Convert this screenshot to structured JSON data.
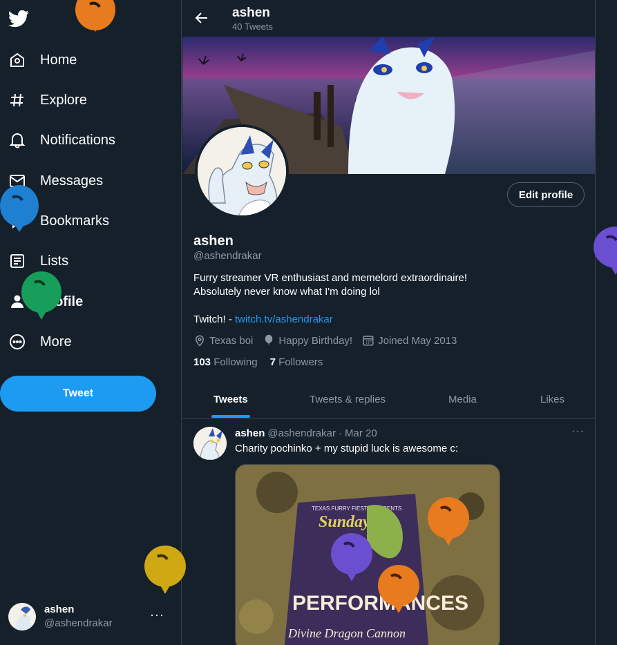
{
  "sidebar": {
    "items": [
      {
        "label": "Home",
        "icon": "home-icon"
      },
      {
        "label": "Explore",
        "icon": "hashtag-icon"
      },
      {
        "label": "Notifications",
        "icon": "bell-icon"
      },
      {
        "label": "Messages",
        "icon": "envelope-icon"
      },
      {
        "label": "Bookmarks",
        "icon": "bookmark-icon"
      },
      {
        "label": "Lists",
        "icon": "list-icon"
      },
      {
        "label": "Profile",
        "icon": "person-icon"
      },
      {
        "label": "More",
        "icon": "more-circle-icon"
      }
    ],
    "tweet_button": "Tweet",
    "account": {
      "name": "ashen",
      "handle": "@ashendrakar",
      "menu": "···"
    }
  },
  "header": {
    "name": "ashen",
    "tweet_count": "40 Tweets"
  },
  "profile": {
    "edit_button": "Edit profile",
    "name": "ashen",
    "handle": "@ashendrakar",
    "bio_line1": "Furry streamer VR enthusiast and memelord extraordinaire!",
    "bio_line2": "Absolutely never know what I'm doing lol",
    "bio_twitch_prefix": "Twitch! - ",
    "bio_twitch_link": "twitch.tv/ashendrakar",
    "location": "Texas boi",
    "birthday": "Happy Birthday!",
    "joined": "Joined May 2013",
    "following_count": "103",
    "following_label": "Following",
    "followers_count": "7",
    "followers_label": "Followers"
  },
  "tabs": [
    "Tweets",
    "Tweets & replies",
    "Media",
    "Likes"
  ],
  "tweet": {
    "name": "ashen",
    "handle": "@ashendrakar",
    "separator": "·",
    "date": "Mar 20",
    "menu": "···",
    "text": "Charity pochinko + my stupid luck is awesome c:",
    "poster_top": "TEXAS FURRY FIESTA PRESENTS",
    "poster_sunday": "Sunday",
    "poster_title": "PERFORMANCES",
    "poster_sub": "Divine Dragon Cannon"
  },
  "colors": {
    "background": "#15202b",
    "accent": "#1d9bf0",
    "muted": "#8b98a5",
    "border": "#38444d"
  }
}
